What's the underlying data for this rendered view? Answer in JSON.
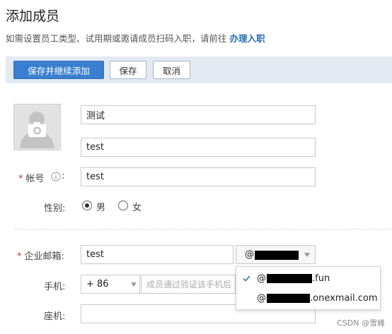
{
  "page": {
    "title": "添加成员",
    "subtitle_text": "如需设置员工类型、试用期或邀请成员扫码入职，请前往",
    "subtitle_link": "办理入职"
  },
  "toolbar": {
    "save_continue_label": "保存并继续添加",
    "save_label": "保存",
    "cancel_label": "取消"
  },
  "form": {
    "name_value": "测试",
    "english_name_value": "test",
    "account": {
      "label": "帐号",
      "value": "test"
    },
    "gender": {
      "label": "性别:",
      "options": [
        "男",
        "女"
      ],
      "selected": "男"
    },
    "email": {
      "label": "企业邮箱:",
      "value": "test",
      "domain_prefix": "@"
    },
    "email_domain_options": [
      {
        "prefix": "@",
        "suffix": ".fun",
        "selected": true
      },
      {
        "prefix": "@",
        "suffix": ".onexmail.com",
        "selected": false
      }
    ],
    "phone": {
      "label": "手机:",
      "country_code": "+ 86",
      "placeholder": "成员通过验证该手机后"
    },
    "landline": {
      "label": "座机:"
    }
  },
  "watermark": "CSDN @雪峰",
  "colors": {
    "primary": "#3a7fcf",
    "link": "#2a6db4",
    "required": "#c0392b",
    "toolbar_bg": "#e4eaf2"
  },
  "icons": [
    "camera-avatar-icon",
    "info-icon",
    "chevron-down-icon",
    "checkmark-icon"
  ]
}
